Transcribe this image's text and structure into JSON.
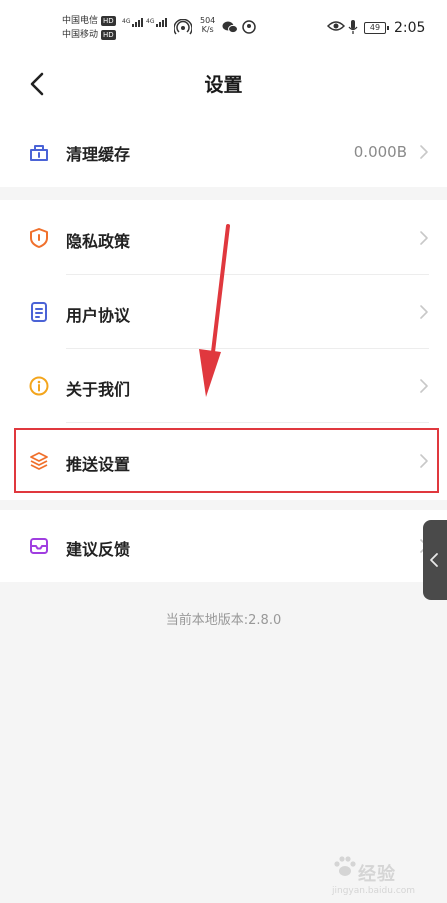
{
  "status_bar": {
    "carrier1": "中国电信",
    "carrier2": "中国移动",
    "hd_badge": "HD",
    "network": "4G",
    "speed_value": "504",
    "speed_unit": "K/s",
    "battery": "49",
    "time": "2:05"
  },
  "header": {
    "title": "设置"
  },
  "settings": {
    "clear_cache": {
      "label": "清理缓存",
      "value": "0.000B"
    },
    "items": [
      {
        "label": "隐私政策"
      },
      {
        "label": "用户协议"
      },
      {
        "label": "关于我们"
      },
      {
        "label": "推送设置"
      }
    ],
    "feedback": {
      "label": "建议反馈"
    }
  },
  "footer": {
    "version": "当前本地版本:2.8.0"
  },
  "colors": {
    "clear_cache_icon": "#4b63d6",
    "privacy_icon": "#f0702c",
    "agreement_icon": "#4b63d6",
    "about_icon": "#f3a51c",
    "push_icon": "#f0702c",
    "feedback_icon": "#a03ee0",
    "highlight": "#e0383e"
  },
  "icons": {
    "clear_cache": "basket-icon",
    "privacy": "shield-icon",
    "agreement": "document-icon",
    "about": "info-icon",
    "push": "layers-icon",
    "feedback": "inbox-icon"
  }
}
